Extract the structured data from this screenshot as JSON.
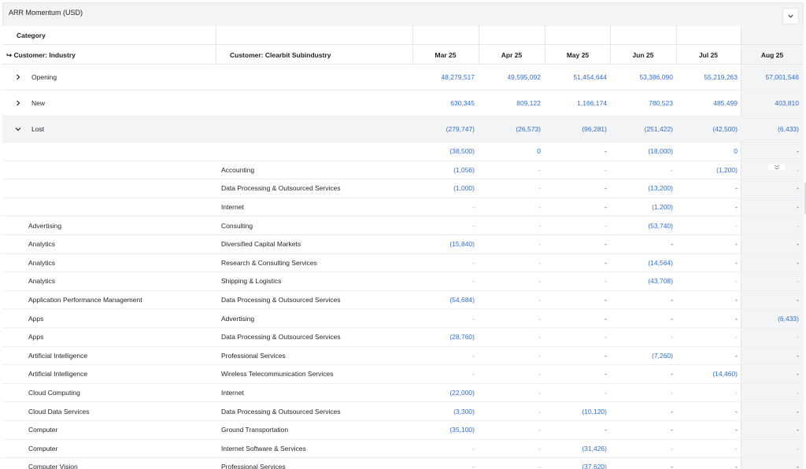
{
  "panel": {
    "title": "ARR Momentum (USD)"
  },
  "header": {
    "category_label": "Category",
    "col1_label": "↪ Customer: Industry",
    "col2_label": "Customer: Clearbit Subindustry",
    "months": [
      "Mar 25",
      "Apr 25",
      "May 25",
      "Jun 25",
      "Jul 25",
      "Aug 25"
    ]
  },
  "groups": [
    {
      "label": "Opening",
      "expanded": false,
      "values": [
        "48,279,517",
        "49,595,092",
        "51,454,644",
        "53,386,090",
        "55,219,263",
        "57,001,546"
      ]
    },
    {
      "label": "New",
      "expanded": false,
      "values": [
        "630,345",
        "809,122",
        "1,166,174",
        "780,523",
        "485,499",
        "403,810"
      ]
    },
    {
      "label": "Lost",
      "expanded": true,
      "values": [
        "(279,747)",
        "(26,573)",
        "(96,281)",
        "(251,422)",
        "(42,500)",
        "(6,433)"
      ]
    }
  ],
  "rows": [
    {
      "industry": "",
      "subindustry": "",
      "values": [
        "(38,500)",
        "0",
        "-",
        "(18,000)",
        "0",
        "-"
      ]
    },
    {
      "industry": "",
      "subindustry": "Accounting",
      "values": [
        "(1,056)",
        "-",
        "-",
        "-",
        "(1,200)",
        "-"
      ]
    },
    {
      "industry": "",
      "subindustry": "Data Processing & Outsourced Services",
      "values": [
        "(1,000)",
        "-",
        "-",
        "(13,200)",
        "-",
        "-"
      ]
    },
    {
      "industry": "",
      "subindustry": "Internet",
      "values": [
        "-",
        "-",
        "-",
        "(1,200)",
        "-",
        "-"
      ]
    },
    {
      "industry": "Advertising",
      "subindustry": "Consulting",
      "values": [
        "-",
        "-",
        "-",
        "(53,740)",
        "-",
        "-"
      ]
    },
    {
      "industry": "Analytics",
      "subindustry": "Diversified Capital Markets",
      "values": [
        "(15,840)",
        "-",
        "-",
        "-",
        "-",
        "-"
      ]
    },
    {
      "industry": "Analytics",
      "subindustry": "Research & Consulting Services",
      "values": [
        "-",
        "-",
        "-",
        "(14,564)",
        "-",
        "-"
      ]
    },
    {
      "industry": "Analytics",
      "subindustry": "Shipping & Logistics",
      "values": [
        "-",
        "-",
        "-",
        "(43,708)",
        "-",
        "-"
      ]
    },
    {
      "industry": "Application Performance Management",
      "subindustry": "Data Processing & Outsourced Services",
      "values": [
        "(54,684)",
        "-",
        "-",
        "-",
        "-",
        "-"
      ]
    },
    {
      "industry": "Apps",
      "subindustry": "Advertising",
      "values": [
        "-",
        "-",
        "-",
        "-",
        "-",
        "(6,433)"
      ]
    },
    {
      "industry": "Apps",
      "subindustry": "Data Processing & Outsourced Services",
      "values": [
        "(28,760)",
        "-",
        "-",
        "-",
        "-",
        "-"
      ]
    },
    {
      "industry": "Artificial Intelligence",
      "subindustry": "Professional Services",
      "values": [
        "-",
        "-",
        "-",
        "(7,260)",
        "-",
        "-"
      ]
    },
    {
      "industry": "Artificial Intelligence",
      "subindustry": "Wireless Telecommunication Services",
      "values": [
        "-",
        "-",
        "-",
        "-",
        "(14,460)",
        "-"
      ]
    },
    {
      "industry": "Cloud Computing",
      "subindustry": "Internet",
      "values": [
        "(22,000)",
        "-",
        "-",
        "-",
        "-",
        "-"
      ]
    },
    {
      "industry": "Cloud Data Services",
      "subindustry": "Data Processing & Outsourced Services",
      "values": [
        "(3,300)",
        "-",
        "(10,120)",
        "-",
        "-",
        "-"
      ]
    },
    {
      "industry": "Computer",
      "subindustry": "Ground Transportation",
      "values": [
        "(35,100)",
        "-",
        "-",
        "-",
        "-",
        "-"
      ]
    },
    {
      "industry": "Computer",
      "subindustry": "Internet Software & Services",
      "values": [
        "-",
        "-",
        "(31,426)",
        "-",
        "-",
        "-"
      ]
    },
    {
      "industry": "Computer Vision",
      "subindustry": "Professional Services",
      "values": [
        "-",
        "-",
        "(37,620)",
        "-",
        "-",
        "-"
      ]
    }
  ],
  "colors": {
    "link": "#2f6fdc",
    "header_bg": "#f3f4f6",
    "muted": "#9aa0a6"
  },
  "icons": {
    "collapse": "chevron-down-icon",
    "expand": "chevron-right-icon"
  }
}
